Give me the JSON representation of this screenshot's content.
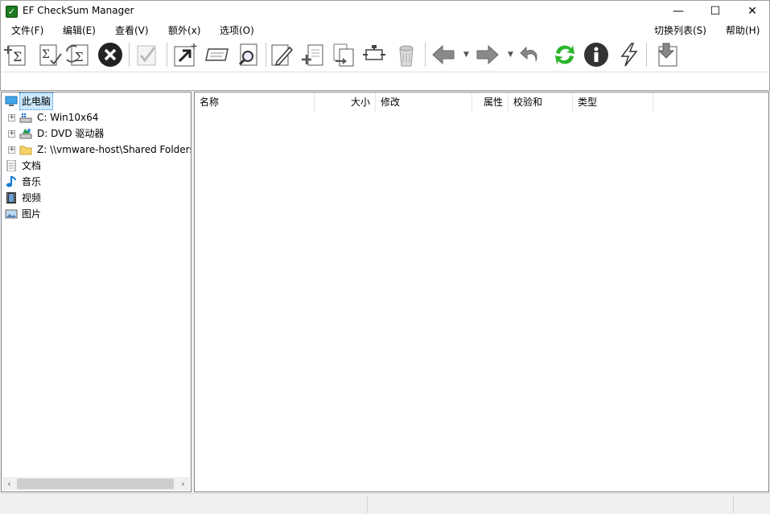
{
  "window": {
    "title": "EF CheckSum Manager",
    "controls": {
      "minimize": "—",
      "maximize": "☐",
      "close": "✕"
    }
  },
  "menu": {
    "left": [
      {
        "label": "文件(F)"
      },
      {
        "label": "编辑(E)"
      },
      {
        "label": "查看(V)"
      },
      {
        "label": "额外(x)"
      },
      {
        "label": "选项(O)"
      }
    ],
    "right": [
      {
        "label": "切换列表(S)"
      },
      {
        "label": "帮助(H)"
      }
    ]
  },
  "toolbar": {
    "icons": [
      "create-checksum-icon",
      "verify-checksum-icon",
      "update-checksum-icon",
      "stop-icon",
      "check-disabled-icon",
      "open-arrow-icon",
      "rename-icon",
      "search-icon",
      "edit-icon",
      "new-file-icon",
      "copy-file-icon",
      "move-file-icon",
      "recycle-icon",
      "back-arrow-icon",
      "forward-arrow-icon",
      "undo-icon",
      "refresh-icon",
      "info-icon",
      "flash-icon",
      "download-icon"
    ]
  },
  "tree": {
    "root": {
      "label": "此电脑",
      "icon": "computer-icon"
    },
    "drives": [
      {
        "label": "C: Win10x64",
        "icon": "drive-icon"
      },
      {
        "label": "D: DVD 驱动器",
        "icon": "dvd-icon"
      },
      {
        "label": "Z: \\\\vmware-host\\Shared Folders",
        "icon": "folder-icon"
      }
    ],
    "libraries": [
      {
        "label": "文档",
        "icon": "document-icon"
      },
      {
        "label": "音乐",
        "icon": "music-icon"
      },
      {
        "label": "视频",
        "icon": "video-icon"
      },
      {
        "label": "图片",
        "icon": "picture-icon"
      }
    ]
  },
  "scroll": {
    "left": "‹",
    "right": "›"
  },
  "columns": [
    {
      "label": "名称"
    },
    {
      "label": "大小"
    },
    {
      "label": "修改"
    },
    {
      "label": "属性"
    },
    {
      "label": "校验和"
    },
    {
      "label": "类型"
    }
  ],
  "colors": {
    "accent": "#0078d7",
    "selection": "#cce8ff",
    "toolbar_green": "#2bb52b"
  }
}
